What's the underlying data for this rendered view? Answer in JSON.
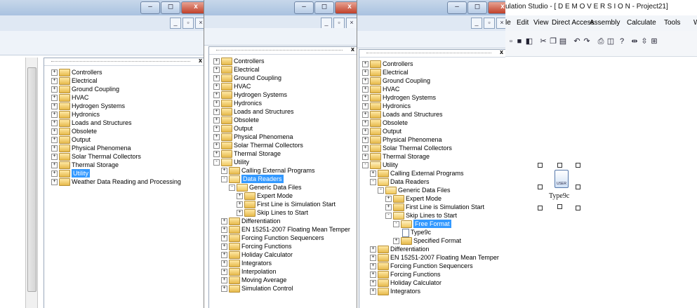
{
  "window_controls": {
    "minimize": "–",
    "restore": "◻",
    "close": "x"
  },
  "mdi_controls": {
    "minimize": "_",
    "restore": "▫",
    "close": "×"
  },
  "panel_close": "x",
  "app_title": "ulation Studio - [ D E M O V E R S I O N - Project21]",
  "menu": [
    "le",
    "Edit",
    "View",
    "Direct Access",
    "Assembly",
    "Calculate",
    "Tools",
    "Wi"
  ],
  "toolbar_icons": [
    "new-icon",
    "save-icon",
    "open-icon",
    "cut-icon",
    "copy-icon",
    "paste-icon",
    "undo-icon",
    "redo-icon",
    "print-icon",
    "preview-icon",
    "help-icon",
    "align-icon",
    "distribute-icon",
    "grid-icon"
  ],
  "component": {
    "tag": "USER",
    "label": "Type9c"
  },
  "tree1": [
    {
      "label": "Controllers",
      "depth": 0,
      "exp": "+",
      "open": false
    },
    {
      "label": "Electrical",
      "depth": 0,
      "exp": "+",
      "open": false
    },
    {
      "label": "Ground Coupling",
      "depth": 0,
      "exp": "+",
      "open": false
    },
    {
      "label": "HVAC",
      "depth": 0,
      "exp": "+",
      "open": false
    },
    {
      "label": "Hydrogen Systems",
      "depth": 0,
      "exp": "+",
      "open": false
    },
    {
      "label": "Hydronics",
      "depth": 0,
      "exp": "+",
      "open": false
    },
    {
      "label": "Loads and Structures",
      "depth": 0,
      "exp": "+",
      "open": false
    },
    {
      "label": "Obsolete",
      "depth": 0,
      "exp": "+",
      "open": false
    },
    {
      "label": "Output",
      "depth": 0,
      "exp": "+",
      "open": false
    },
    {
      "label": "Physical Phenomena",
      "depth": 0,
      "exp": "+",
      "open": false
    },
    {
      "label": "Solar Thermal Collectors",
      "depth": 0,
      "exp": "+",
      "open": false
    },
    {
      "label": "Thermal Storage",
      "depth": 0,
      "exp": "+",
      "open": false
    },
    {
      "label": "Utility",
      "depth": 0,
      "exp": "+",
      "open": false,
      "selected": true
    },
    {
      "label": "Weather Data Reading and Processing",
      "depth": 0,
      "exp": "+",
      "open": false
    }
  ],
  "tree2": [
    {
      "label": "Controllers",
      "depth": 0,
      "exp": "+",
      "open": false
    },
    {
      "label": "Electrical",
      "depth": 0,
      "exp": "+",
      "open": false
    },
    {
      "label": "Ground Coupling",
      "depth": 0,
      "exp": "+",
      "open": false
    },
    {
      "label": "HVAC",
      "depth": 0,
      "exp": "+",
      "open": false
    },
    {
      "label": "Hydrogen Systems",
      "depth": 0,
      "exp": "+",
      "open": false
    },
    {
      "label": "Hydronics",
      "depth": 0,
      "exp": "+",
      "open": false
    },
    {
      "label": "Loads and Structures",
      "depth": 0,
      "exp": "+",
      "open": false
    },
    {
      "label": "Obsolete",
      "depth": 0,
      "exp": "+",
      "open": false
    },
    {
      "label": "Output",
      "depth": 0,
      "exp": "+",
      "open": false
    },
    {
      "label": "Physical Phenomena",
      "depth": 0,
      "exp": "+",
      "open": false
    },
    {
      "label": "Solar Thermal Collectors",
      "depth": 0,
      "exp": "+",
      "open": false
    },
    {
      "label": "Thermal Storage",
      "depth": 0,
      "exp": "+",
      "open": false
    },
    {
      "label": "Utility",
      "depth": 0,
      "exp": "-",
      "open": true
    },
    {
      "label": "Calling External Programs",
      "depth": 1,
      "exp": "+",
      "open": false
    },
    {
      "label": "Data Readers",
      "depth": 1,
      "exp": "-",
      "open": true,
      "selected": true
    },
    {
      "label": "Generic Data Files",
      "depth": 2,
      "exp": "-",
      "open": true
    },
    {
      "label": "Expert Mode",
      "depth": 3,
      "exp": "+",
      "open": false
    },
    {
      "label": "First Line is Simulation Start",
      "depth": 3,
      "exp": "+",
      "open": false
    },
    {
      "label": "Skip Lines to Start",
      "depth": 3,
      "exp": "+",
      "open": false
    },
    {
      "label": "Differentiation",
      "depth": 1,
      "exp": "+",
      "open": false
    },
    {
      "label": "EN 15251-2007 Floating Mean Temper",
      "depth": 1,
      "exp": "+",
      "open": false
    },
    {
      "label": "Forcing Function Sequencers",
      "depth": 1,
      "exp": "+",
      "open": false
    },
    {
      "label": "Forcing Functions",
      "depth": 1,
      "exp": "+",
      "open": false
    },
    {
      "label": "Holiday Calculator",
      "depth": 1,
      "exp": "+",
      "open": false
    },
    {
      "label": "Integrators",
      "depth": 1,
      "exp": "+",
      "open": false
    },
    {
      "label": "Interpolation",
      "depth": 1,
      "exp": "+",
      "open": false
    },
    {
      "label": "Moving Average",
      "depth": 1,
      "exp": "+",
      "open": false
    },
    {
      "label": "Simulation Control",
      "depth": 1,
      "exp": "+",
      "open": false
    }
  ],
  "tree3": [
    {
      "label": "Controllers",
      "depth": 0,
      "exp": "+",
      "open": false
    },
    {
      "label": "Electrical",
      "depth": 0,
      "exp": "+",
      "open": false
    },
    {
      "label": "Ground Coupling",
      "depth": 0,
      "exp": "+",
      "open": false
    },
    {
      "label": "HVAC",
      "depth": 0,
      "exp": "+",
      "open": false
    },
    {
      "label": "Hydrogen Systems",
      "depth": 0,
      "exp": "+",
      "open": false
    },
    {
      "label": "Hydronics",
      "depth": 0,
      "exp": "+",
      "open": false
    },
    {
      "label": "Loads and Structures",
      "depth": 0,
      "exp": "+",
      "open": false
    },
    {
      "label": "Obsolete",
      "depth": 0,
      "exp": "+",
      "open": false
    },
    {
      "label": "Output",
      "depth": 0,
      "exp": "+",
      "open": false
    },
    {
      "label": "Physical Phenomena",
      "depth": 0,
      "exp": "+",
      "open": false
    },
    {
      "label": "Solar Thermal Collectors",
      "depth": 0,
      "exp": "+",
      "open": false
    },
    {
      "label": "Thermal Storage",
      "depth": 0,
      "exp": "+",
      "open": false
    },
    {
      "label": "Utility",
      "depth": 0,
      "exp": "-",
      "open": true
    },
    {
      "label": "Calling External Programs",
      "depth": 1,
      "exp": "+",
      "open": false
    },
    {
      "label": "Data Readers",
      "depth": 1,
      "exp": "-",
      "open": true
    },
    {
      "label": "Generic Data Files",
      "depth": 2,
      "exp": "-",
      "open": true
    },
    {
      "label": "Expert Mode",
      "depth": 3,
      "exp": "+",
      "open": false
    },
    {
      "label": "First Line is Simulation Start",
      "depth": 3,
      "exp": "+",
      "open": false
    },
    {
      "label": "Skip Lines to Start",
      "depth": 3,
      "exp": "-",
      "open": true
    },
    {
      "label": "Free Format",
      "depth": 4,
      "exp": "-",
      "open": true,
      "selected": true
    },
    {
      "label": "Type9c",
      "depth": 5,
      "exp": "",
      "leaf": true
    },
    {
      "label": "Specified Format",
      "depth": 4,
      "exp": "+",
      "open": false
    },
    {
      "label": "Differentiation",
      "depth": 1,
      "exp": "+",
      "open": false
    },
    {
      "label": "EN 15251-2007 Floating Mean Temper",
      "depth": 1,
      "exp": "+",
      "open": false
    },
    {
      "label": "Forcing Function Sequencers",
      "depth": 1,
      "exp": "+",
      "open": false
    },
    {
      "label": "Forcing Functions",
      "depth": 1,
      "exp": "+",
      "open": false
    },
    {
      "label": "Holiday Calculator",
      "depth": 1,
      "exp": "+",
      "open": false
    },
    {
      "label": "Integrators",
      "depth": 1,
      "exp": "+",
      "open": false
    }
  ]
}
